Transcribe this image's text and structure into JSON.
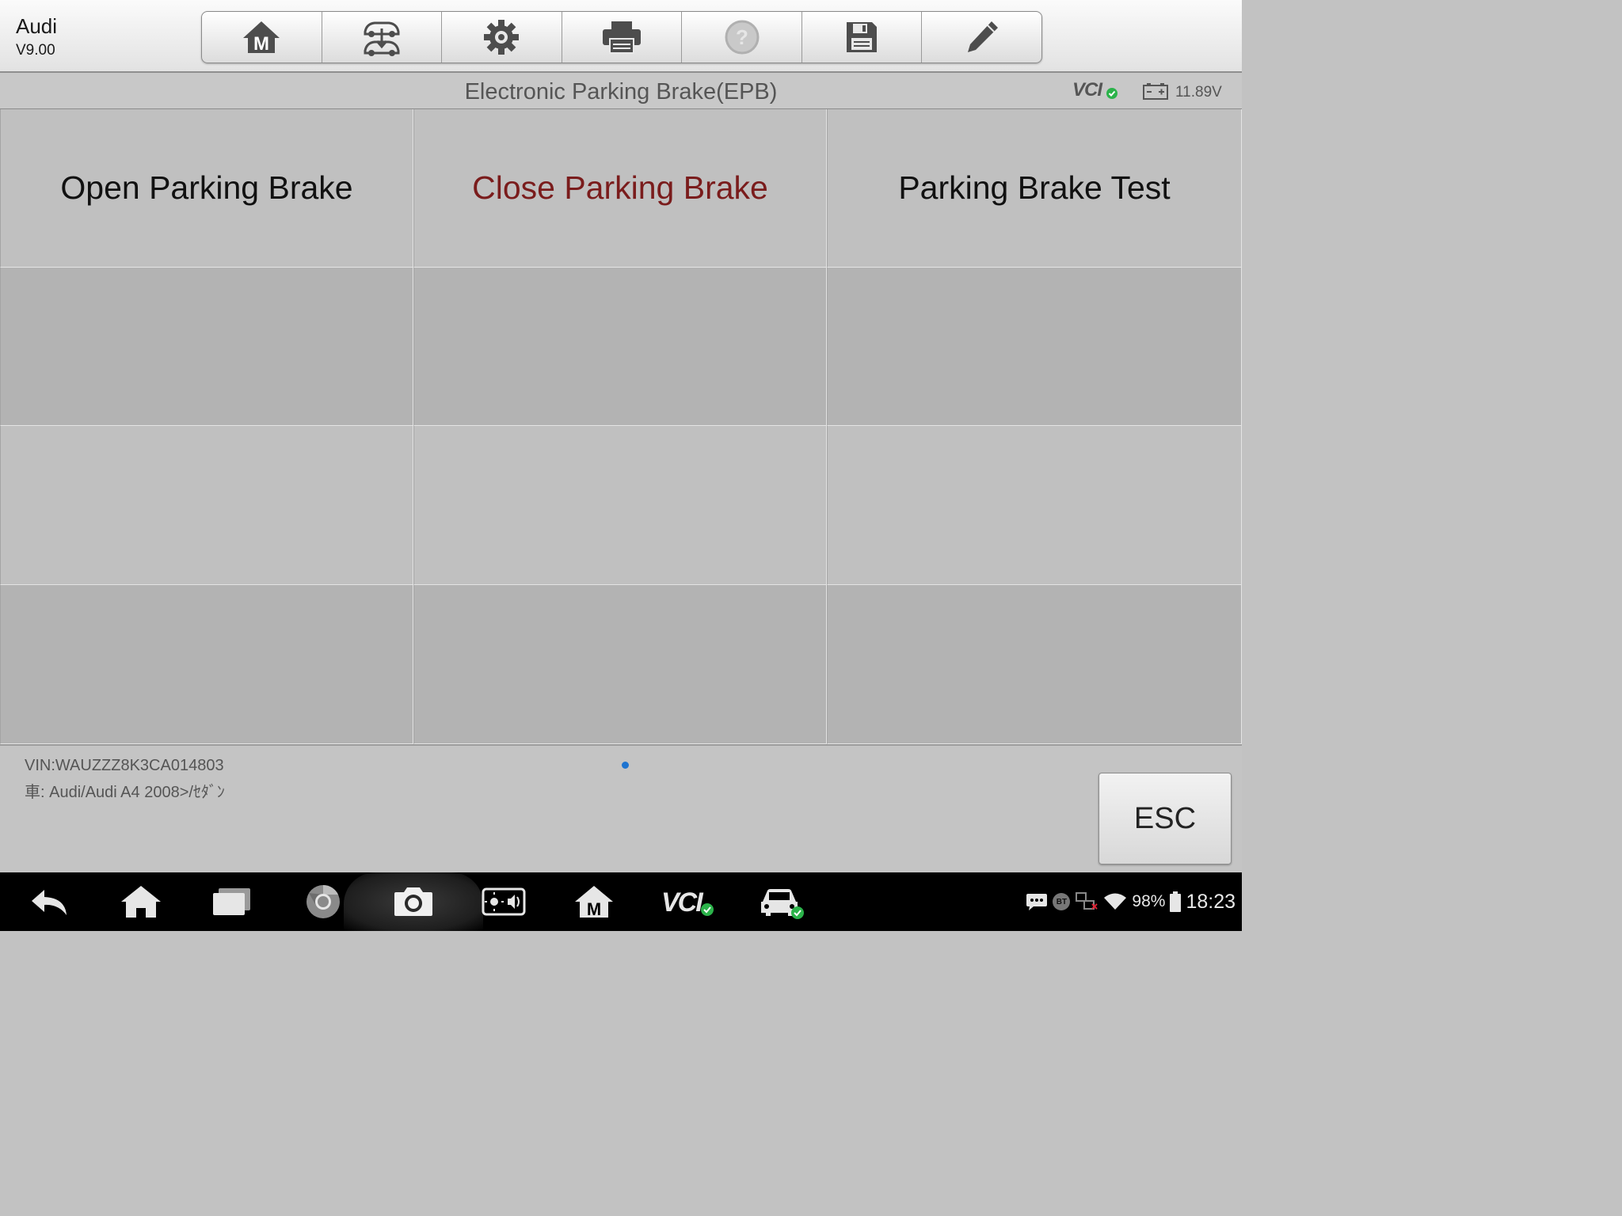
{
  "app": {
    "name": "Audi",
    "version": "V9.00"
  },
  "toolbar": {
    "buttons": [
      {
        "icon": "home-m-icon"
      },
      {
        "icon": "vehicle-swap-icon"
      },
      {
        "icon": "settings-gear-icon"
      },
      {
        "icon": "printer-icon"
      },
      {
        "icon": "help-icon",
        "disabled": true
      },
      {
        "icon": "save-disk-icon"
      },
      {
        "icon": "edit-pencil-icon"
      }
    ]
  },
  "titlebar": {
    "title": "Electronic Parking Brake(EPB)",
    "vcl_label": "VCI",
    "voltage": "11.89V"
  },
  "grid": {
    "items": [
      "Open Parking Brake",
      "Close Parking Brake",
      "Parking Brake Test"
    ],
    "selected_index": 1,
    "selected_color": "#7a1c1c"
  },
  "footer": {
    "vin": "VIN:WAUZZZ8K3CA014803",
    "vehicle": "車: Audi/Audi A4 2008>/ｾﾀﾞﾝ",
    "esc_label": "ESC"
  },
  "navbar": {
    "icons": [
      "back-icon",
      "home-icon",
      "recent-apps-icon",
      "chrome-icon",
      "camera-icon",
      "display-audio-icon",
      "maxisys-m-icon",
      "vci-icon",
      "vehicle-icon"
    ],
    "vci_label": "VCI"
  },
  "status_bar": {
    "battery_percent": "98%",
    "time": "18:23",
    "bt_label": "BT"
  },
  "colors": {
    "accent_blue": "#1e74d0",
    "check_green": "#2bb34a"
  }
}
